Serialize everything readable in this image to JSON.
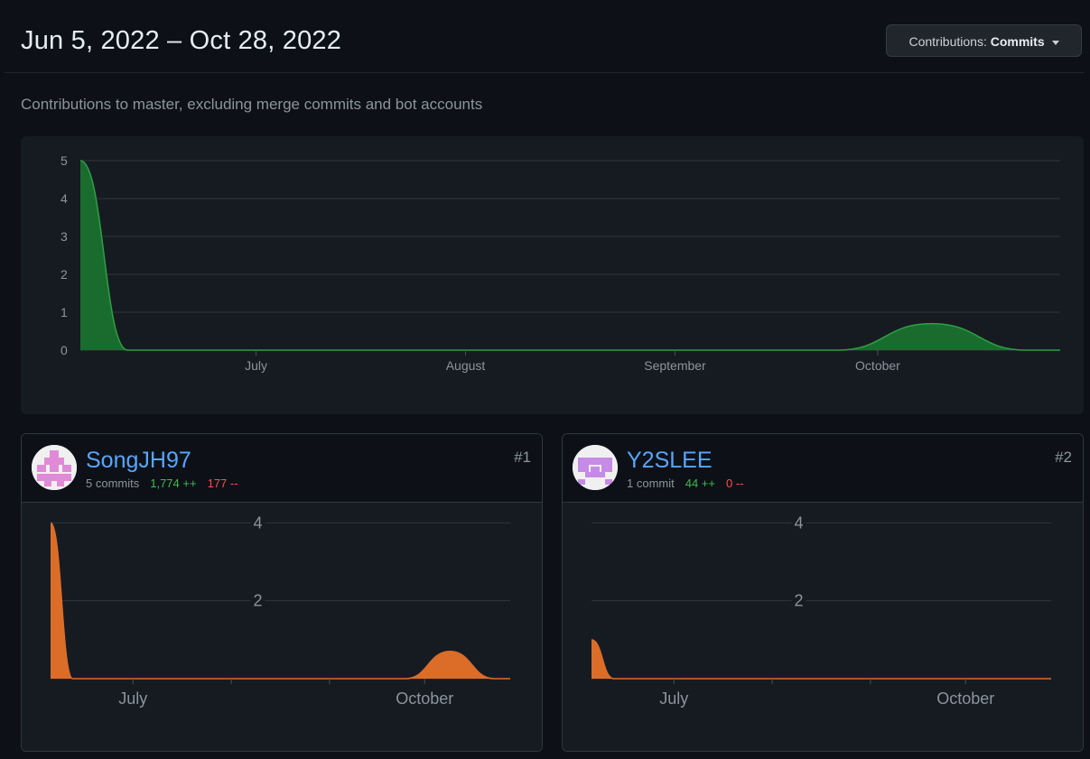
{
  "header": {
    "title": "Jun 5, 2022 – Oct 28, 2022",
    "button_prefix": "Contributions:",
    "button_value": "Commits"
  },
  "description": "Contributions to master, excluding merge commits and bot accounts",
  "colors": {
    "background": "#0d1117",
    "panel": "#161b22",
    "overall_fill": "#196c2e",
    "overall_stroke": "#2ea043",
    "contributor_fill": "#db6d28",
    "link": "#58a6ff",
    "additions": "#3fb950",
    "deletions": "#f85149"
  },
  "chart_data": [
    {
      "type": "area",
      "series": [
        {
          "points": [
            {
              "x": "2022-06-05",
              "y": 5
            },
            {
              "x": "2022-06-12",
              "y": 0
            },
            {
              "x": "2022-06-19",
              "y": 0
            },
            {
              "x": "2022-09-25",
              "y": 0
            },
            {
              "x": "2022-10-09",
              "y": 0.7
            },
            {
              "x": "2022-10-23",
              "y": 0
            },
            {
              "x": "2022-10-28",
              "y": 0
            }
          ]
        }
      ],
      "xticks": [
        "July",
        "August",
        "September",
        "October"
      ],
      "yticks": [
        0,
        1,
        2,
        3,
        4,
        5
      ],
      "ylim": [
        0,
        5
      ],
      "grid": true
    },
    {
      "type": "area",
      "series": [
        {
          "points": [
            {
              "x": "2022-06-05",
              "y": 4
            },
            {
              "x": "2022-06-12",
              "y": 0
            },
            {
              "x": "2022-09-25",
              "y": 0
            },
            {
              "x": "2022-10-09",
              "y": 0.7
            },
            {
              "x": "2022-10-23",
              "y": 0
            },
            {
              "x": "2022-10-28",
              "y": 0
            }
          ]
        }
      ],
      "xticks": [
        "July",
        "October"
      ],
      "yticks": [
        2,
        4
      ],
      "ylim": [
        0,
        4.1
      ],
      "grid": true
    },
    {
      "type": "area",
      "series": [
        {
          "points": [
            {
              "x": "2022-06-05",
              "y": 1
            },
            {
              "x": "2022-06-12",
              "y": 0
            },
            {
              "x": "2022-10-28",
              "y": 0
            }
          ]
        }
      ],
      "xticks": [
        "July",
        "October"
      ],
      "yticks": [
        2,
        4
      ],
      "ylim": [
        0,
        4.1
      ],
      "grid": true
    }
  ],
  "contributors": [
    {
      "rank": "#1",
      "username": "SongJH97",
      "commits": "5 commits",
      "additions": "1,774 ++",
      "deletions": "177 --",
      "avatar_icon": "identicon-pink-pattern"
    },
    {
      "rank": "#2",
      "username": "Y2SLEE",
      "commits": "1 commit",
      "additions": "44 ++",
      "deletions": "0 --",
      "avatar_icon": "identicon-violet-pattern"
    }
  ]
}
